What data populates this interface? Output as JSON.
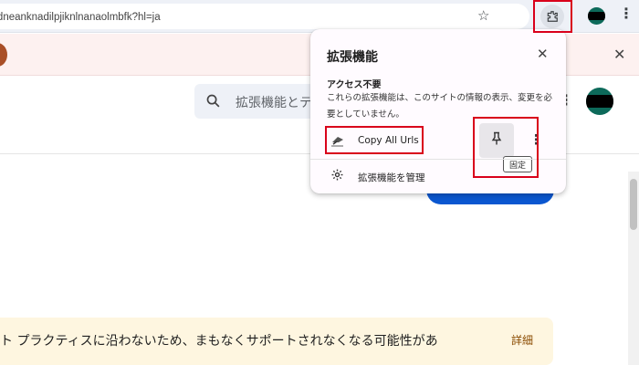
{
  "browser": {
    "url": "jdmadneanknadilpjiknlnanaolmbfk?hl=ja"
  },
  "page": {
    "search_placeholder": "拡張機能とテ",
    "warning_text": "ト プラクティスに沿わないため、まもなくサポートされなくなる可能性があ",
    "warning_link": "詳細"
  },
  "popup": {
    "title": "拡張機能",
    "section_title": "アクセス不要",
    "section_desc": "これらの拡張機能は、このサイトの情報の表示、変更を必要としていません。",
    "extension_name": "Copy All Urls",
    "pin_tooltip": "固定",
    "manage_label": "拡張機能を管理"
  },
  "icons": {
    "star": "bookmark-star-icon",
    "extensions": "puzzle-icon",
    "menu": "kebab-icon",
    "close": "close-icon",
    "search": "search-icon",
    "pin": "pin-icon",
    "settings": "gear-icon"
  },
  "colors": {
    "highlight": "#d9001b",
    "accent": "#0b57d0",
    "warning_bg": "#fef6e0",
    "infobar_bg": "#fdf1f0"
  }
}
